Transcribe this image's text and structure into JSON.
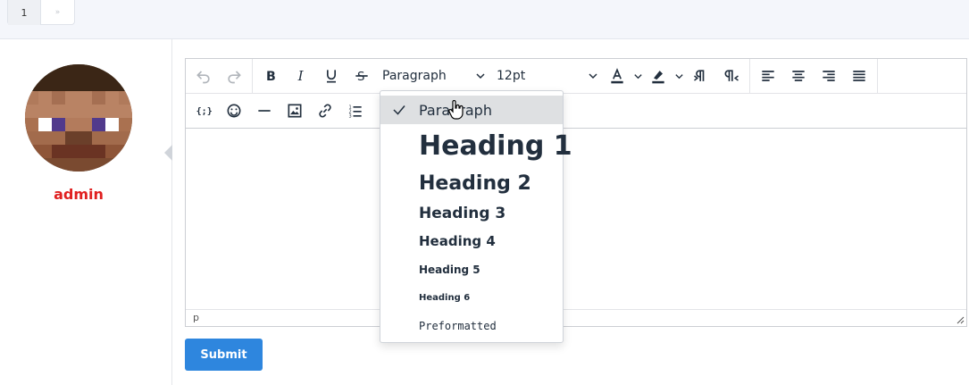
{
  "pagination": {
    "current": "1",
    "next": "»"
  },
  "user": {
    "name": "admin"
  },
  "toolbar": {
    "block_format": "Paragraph",
    "font_size": "12pt"
  },
  "statusbar": {
    "path": "p"
  },
  "submit_label": "Submit",
  "format_menu": {
    "items": [
      {
        "label": "Paragraph",
        "selected": true
      },
      {
        "label": "Heading 1"
      },
      {
        "label": "Heading 2"
      },
      {
        "label": "Heading 3"
      },
      {
        "label": "Heading 4"
      },
      {
        "label": "Heading 5"
      },
      {
        "label": "Heading 6"
      },
      {
        "label": "Preformatted"
      }
    ]
  },
  "colors": {
    "accent": "#2e86de",
    "username": "#e02020"
  }
}
